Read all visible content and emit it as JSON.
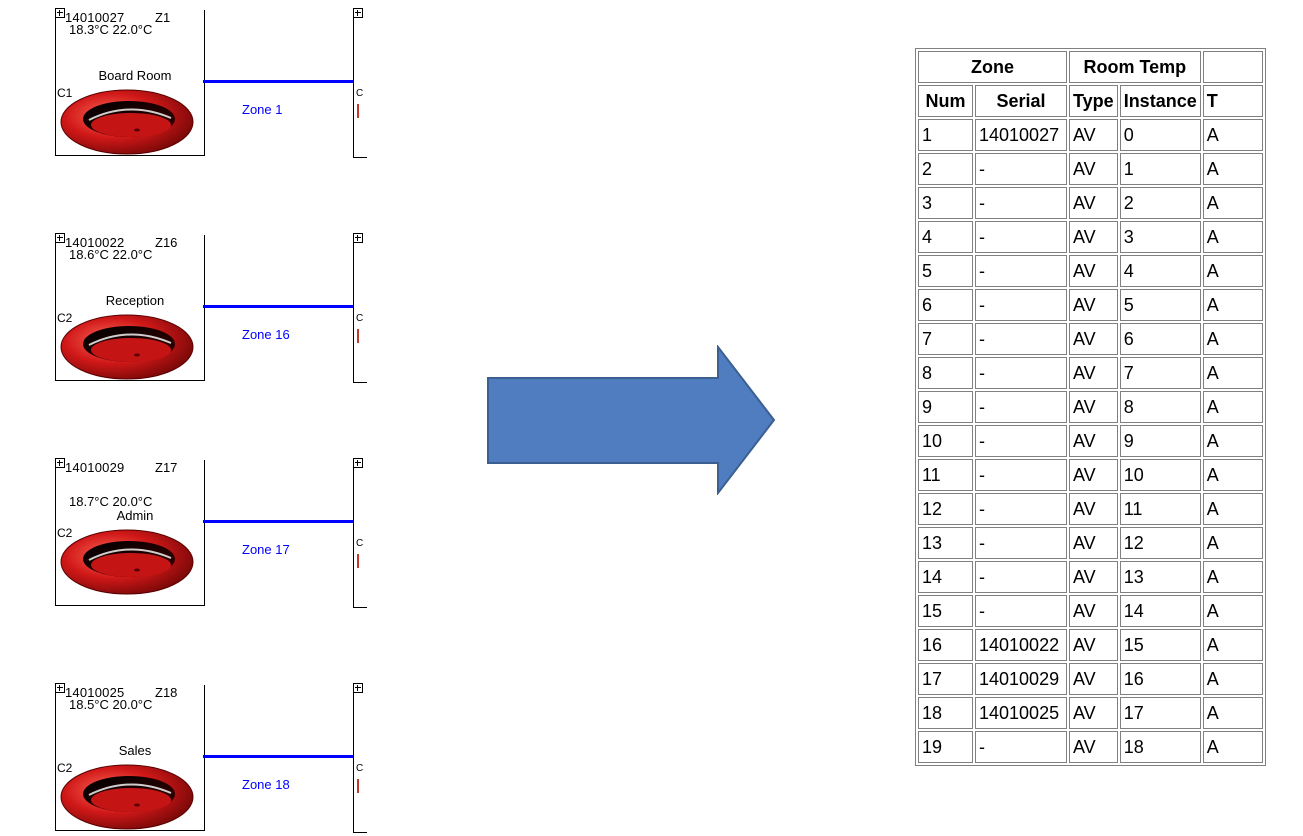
{
  "zones": [
    {
      "serial": "14010027",
      "zone_code": "Z1",
      "temps": "18.3°C  22.0°C",
      "room": "Board Room",
      "controller": "C1",
      "zone_label": "Zone 1",
      "temps_row": "upper"
    },
    {
      "serial": "14010022",
      "zone_code": "Z16",
      "temps": "18.6°C  22.0°C",
      "room": "Reception",
      "controller": "C2",
      "zone_label": "Zone 16",
      "temps_row": "upper"
    },
    {
      "serial": "14010029",
      "zone_code": "Z17",
      "temps": "18.7°C  20.0°C",
      "room": "Admin",
      "controller": "C2",
      "zone_label": "Zone 17",
      "temps_row": "lower"
    },
    {
      "serial": "14010025",
      "zone_code": "Z18",
      "temps": "18.5°C  20.0°C",
      "room": "Sales",
      "controller": "C2",
      "zone_label": "Zone 18",
      "temps_row": "upper"
    }
  ],
  "right_tile_label": "C",
  "table": {
    "group_headers": [
      "Zone",
      "Room Temp",
      ""
    ],
    "col_headers": [
      "Num",
      "Serial",
      "Type",
      "Instance",
      "T"
    ],
    "rows": [
      [
        "1",
        "14010027",
        "AV",
        "0",
        "A"
      ],
      [
        "2",
        "-",
        "AV",
        "1",
        "A"
      ],
      [
        "3",
        "-",
        "AV",
        "2",
        "A"
      ],
      [
        "4",
        "-",
        "AV",
        "3",
        "A"
      ],
      [
        "5",
        "-",
        "AV",
        "4",
        "A"
      ],
      [
        "6",
        "-",
        "AV",
        "5",
        "A"
      ],
      [
        "7",
        "-",
        "AV",
        "6",
        "A"
      ],
      [
        "8",
        "-",
        "AV",
        "7",
        "A"
      ],
      [
        "9",
        "-",
        "AV",
        "8",
        "A"
      ],
      [
        "10",
        "-",
        "AV",
        "9",
        "A"
      ],
      [
        "11",
        "-",
        "AV",
        "10",
        "A"
      ],
      [
        "12",
        "-",
        "AV",
        "11",
        "A"
      ],
      [
        "13",
        "-",
        "AV",
        "12",
        "A"
      ],
      [
        "14",
        "-",
        "AV",
        "13",
        "A"
      ],
      [
        "15",
        "-",
        "AV",
        "14",
        "A"
      ],
      [
        "16",
        "14010022",
        "AV",
        "15",
        "A"
      ],
      [
        "17",
        "14010029",
        "AV",
        "16",
        "A"
      ],
      [
        "18",
        "14010025",
        "AV",
        "17",
        "A"
      ],
      [
        "19",
        "-",
        "AV",
        "18",
        "A"
      ]
    ]
  },
  "colors": {
    "link_line": "#0000ff",
    "zone_label": "#0000ff",
    "arrow_fill": "#4f7dbf",
    "arrow_stroke": "#3b5f91",
    "thermostat": "#cc1a1a"
  }
}
